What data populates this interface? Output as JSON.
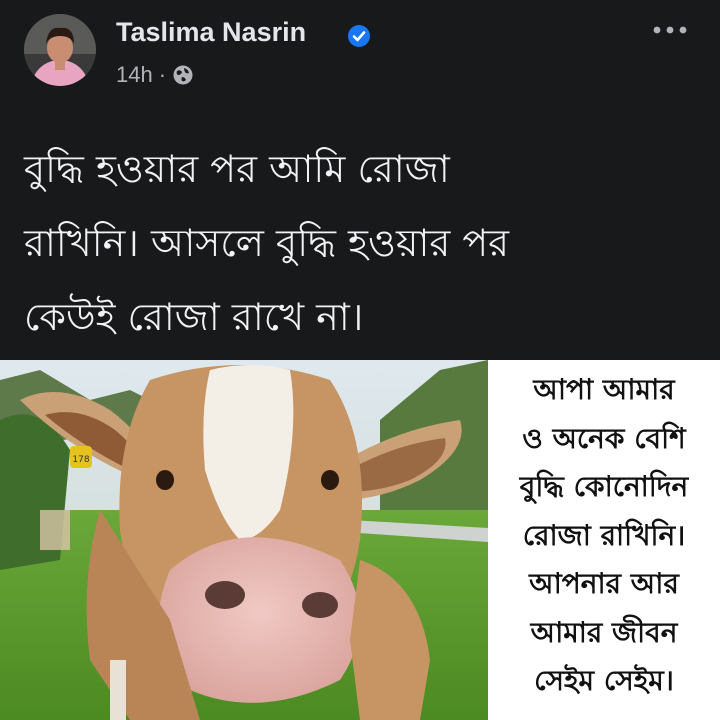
{
  "post": {
    "author": "Taslima Nasrin",
    "time": "14h",
    "separator": "·",
    "privacy_icon": "globe-icon",
    "verified_icon": "verified-badge-icon",
    "more_icon": "more-horizontal-icon",
    "text_lines": [
      "বুদ্ধি হওয়ার পর আমি রোজা",
      "রাখিনি। আসলে বুদ্ধি হওয়ার পর",
      "কেউই রোজা রাখে না।"
    ]
  },
  "image": {
    "ear_tag": "178",
    "meme_lines": [
      "আপা আমার",
      "ও অনেক বেশি",
      "বুদ্ধি কোনোদিন",
      "রোজা রাখিনি।",
      "আপনার আর",
      "আমার জীবন",
      "সেইম সেইম।"
    ]
  },
  "colors": {
    "background": "#18191a",
    "text_primary": "#e4e6eb",
    "text_secondary": "#b0b3b8",
    "verified": "#1877f2"
  }
}
